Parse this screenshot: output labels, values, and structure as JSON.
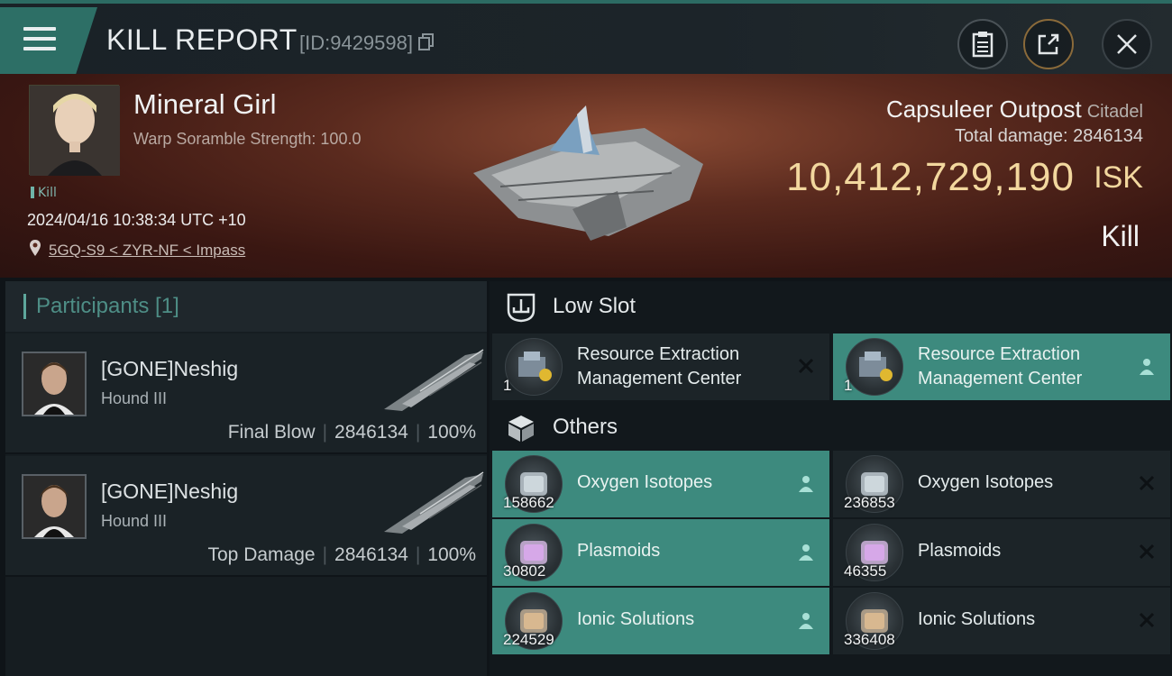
{
  "header": {
    "title": "KILL REPORT",
    "report_id": "[ID:9429598]",
    "icons": {
      "menu": "hamburger-menu-icon",
      "copy": "copy-icon",
      "clipboard": "clipboard-icon",
      "share": "share-icon",
      "close": "close-icon"
    }
  },
  "victim": {
    "name": "Mineral Girl",
    "scramble": "Warp Soramble Strength: 100.0",
    "tag": "Kill",
    "timestamp": "2024/04/16 10:38:34 UTC +10",
    "location": "5GQ-S9 < ZYR-NF < Impass",
    "structure": "Capsuleer Outpost",
    "structure_class": "Citadel",
    "total_damage": "Total damage: 2846134",
    "isk_value": "10,412,729,190",
    "isk_unit": "ISK",
    "result": "Kill"
  },
  "participants": {
    "title": "Participants [1]",
    "list": [
      {
        "name": "[GONE]Neshig",
        "ship": "Hound III",
        "role": "Final Blow",
        "damage": "2846134",
        "percent": "100%"
      },
      {
        "name": "[GONE]Neshig",
        "ship": "Hound III",
        "role": "Top Damage",
        "damage": "2846134",
        "percent": "100%"
      }
    ]
  },
  "sections": {
    "low_slot": "Low Slot",
    "others": "Others"
  },
  "low_slot_items": [
    {
      "qty": "1",
      "name": "Resource Extraction Management Center",
      "status": "destroyed"
    },
    {
      "qty": "1",
      "name": "Resource Extraction Management Center",
      "status": "dropped"
    }
  ],
  "other_items": [
    {
      "qty": "158662",
      "name": "Oxygen Isotopes",
      "status": "dropped"
    },
    {
      "qty": "236853",
      "name": "Oxygen Isotopes",
      "status": "destroyed"
    },
    {
      "qty": "30802",
      "name": "Plasmoids",
      "status": "dropped"
    },
    {
      "qty": "46355",
      "name": "Plasmoids",
      "status": "destroyed"
    },
    {
      "qty": "224529",
      "name": "Ionic Solutions",
      "status": "dropped"
    },
    {
      "qty": "336408",
      "name": "Ionic Solutions",
      "status": "destroyed"
    }
  ],
  "colors": {
    "accent": "#3d8a7e",
    "isk": "#f2d79e",
    "banner": "#5a2a1e"
  }
}
